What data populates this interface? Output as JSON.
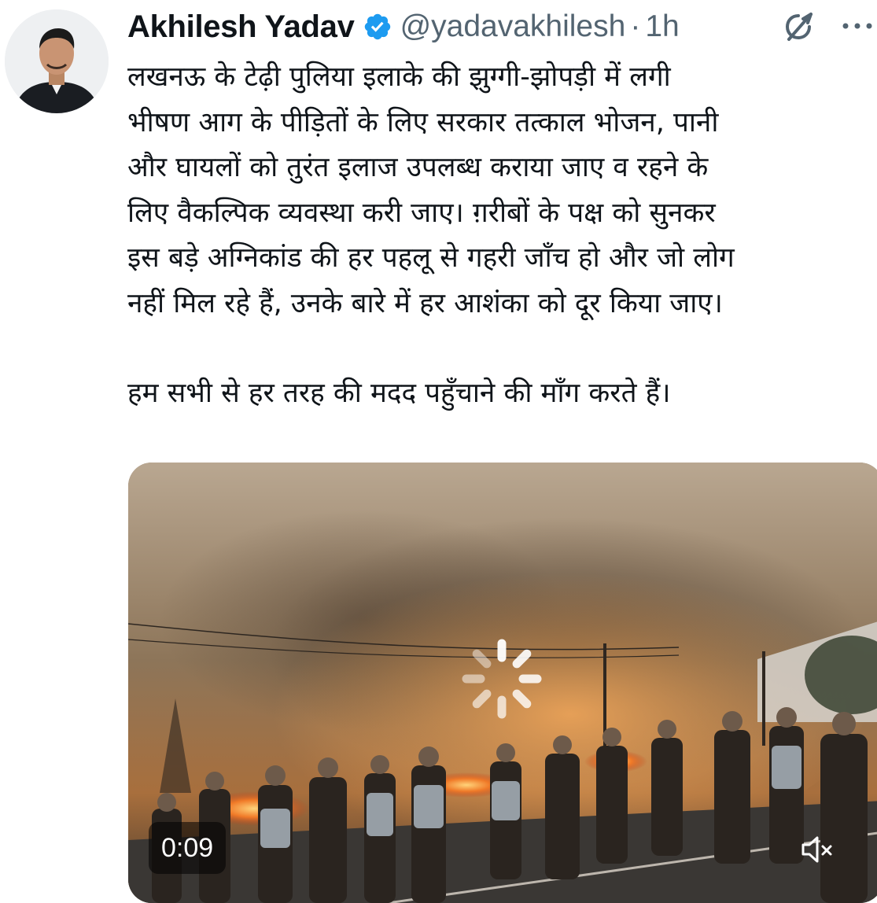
{
  "author": {
    "name": "Akhilesh Yadav",
    "handle": "@yadavakhilesh",
    "separator": "·",
    "time": "1h",
    "verified": true
  },
  "tweet": {
    "lines": [
      "लखनऊ के टेढ़ी पुलिया इलाके की झुग्गी-झोपड़ी में लगी",
      "भीषण आग के पीड़ितों के लिए सरकार तत्काल भोजन, पानी",
      "और घायलों को तुरंत इलाज उपलब्ध कराया जाए व रहने के",
      "लिए वैकल्पिक व्यवस्था करी जाए। ग़रीबों के पक्ष को सुनकर",
      "इस बड़े अग्निकांड की हर पहलू से गहरी जाँच हो और जो लोग",
      "नहीं मिल रहे हैं, उनके बारे में हर आशंका को दूर किया जाए।"
    ],
    "paragraph2": "हम सभी से हर तरह की मदद पहुँचाने की माँग करते हैं।"
  },
  "media": {
    "type": "video",
    "timecode": "0:09",
    "muted": true,
    "loading": true
  },
  "icons": {
    "verified": "verified-badge-icon",
    "grok": "grok-icon",
    "more": "more-icon",
    "mute": "volume-muted-icon",
    "spinner": "loading-spinner-icon"
  },
  "colors": {
    "verified_blue": "#1d9bf0",
    "secondary_text": "#536471",
    "primary_text": "#0f1419"
  }
}
